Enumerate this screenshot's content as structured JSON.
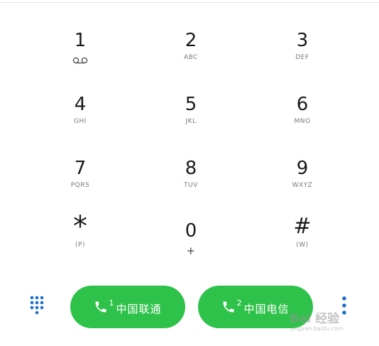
{
  "keypad": {
    "keys": [
      {
        "digit": "1",
        "sub": "",
        "sub_icon": "voicemail-icon"
      },
      {
        "digit": "2",
        "sub": "ABC"
      },
      {
        "digit": "3",
        "sub": "DEF"
      },
      {
        "digit": "4",
        "sub": "GHI"
      },
      {
        "digit": "5",
        "sub": "JKL"
      },
      {
        "digit": "6",
        "sub": "MNO"
      },
      {
        "digit": "7",
        "sub": "PQRS"
      },
      {
        "digit": "8",
        "sub": "TUV"
      },
      {
        "digit": "9",
        "sub": "WXYZ"
      },
      {
        "digit": "*",
        "sub": "(P)"
      },
      {
        "digit": "0",
        "sub": "+"
      },
      {
        "digit": "#",
        "sub": "(W)"
      }
    ]
  },
  "call_buttons": [
    {
      "sim": "1",
      "carrier": "中国联通",
      "icon": "phone-icon"
    },
    {
      "sim": "2",
      "carrier": "中国电信",
      "icon": "phone-icon"
    }
  ],
  "controls": {
    "dialpad_toggle_icon": "dialpad-grid-icon",
    "more_icon": "more-vert-icon"
  },
  "watermark": {
    "text": "Bai 经验",
    "url": "jingyan.baidu.com"
  },
  "colors": {
    "call_button": "#2fc24a",
    "accent_blue": "#1e6fd0",
    "digit": "#1a1a1a",
    "sub_label": "#7a7a7a"
  }
}
